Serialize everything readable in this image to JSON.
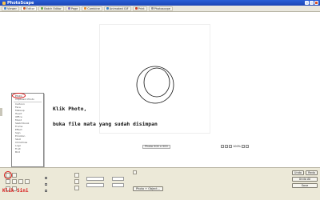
{
  "window": {
    "title": "PhotoScape"
  },
  "tabs": [
    {
      "label": "Viewer",
      "color": "#4a8bd6"
    },
    {
      "label": "Editor",
      "color": "#c75b2a"
    },
    {
      "label": "Batch Editor",
      "color": "#6aa84f"
    },
    {
      "label": "Page",
      "color": "#8e7cc3"
    },
    {
      "label": "Combine",
      "color": "#e69138"
    },
    {
      "label": "Animated GIF",
      "color": "#3d85c6"
    },
    {
      "label": "Print",
      "color": "#cc4125"
    },
    {
      "label": "Photoscape",
      "color": "#999999"
    }
  ],
  "dropdown": {
    "items": [
      "Photo",
      "Clipboard Photo",
      "Cartoon",
      "Face",
      "Makeup",
      "Heart",
      "Office",
      "Mood",
      "Sketchbook",
      "Frame",
      "Effect",
      "Sign",
      "Emotion",
      "Skull",
      "Christmas",
      "Logo",
      "Fruit",
      "Bird"
    ]
  },
  "annotations": {
    "line1": "Klik Photo,",
    "line2": "buka file mata yang sudah disimpan",
    "bottom": "Klik Sini"
  },
  "status": {
    "size": "Photo 500 x 500",
    "zoom": "100%"
  },
  "right_buttons": {
    "undo": "Undo",
    "redo": "Redo",
    "undo_all": "Undo All",
    "save": "Save"
  },
  "tools": {
    "photo_object": "Photo + Object..."
  },
  "highlight_color": "#d81818"
}
